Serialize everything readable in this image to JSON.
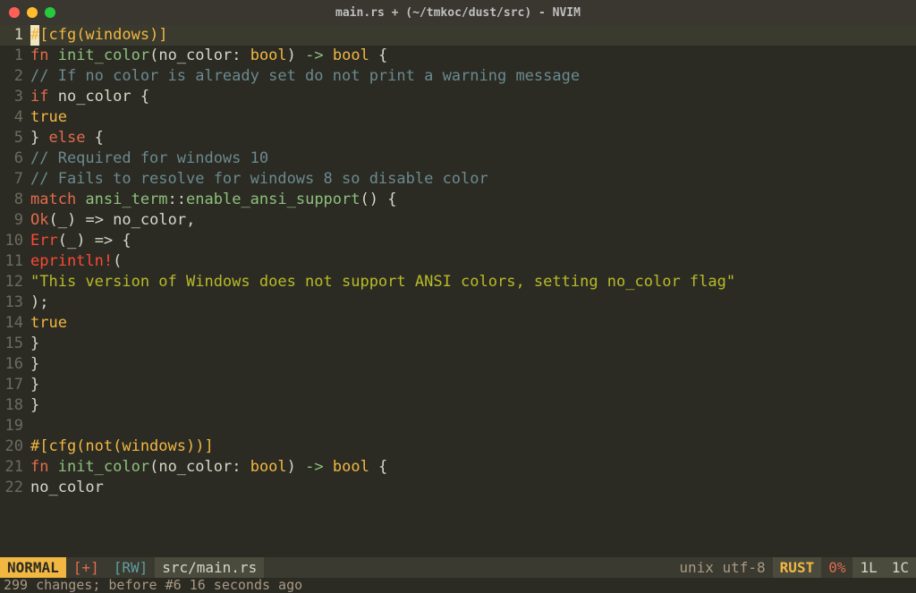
{
  "window": {
    "title": "main.rs + (~/tmkoc/dust/src) - NVIM"
  },
  "cursor": {
    "line": 1,
    "col": 1
  },
  "code": [
    {
      "n": 1,
      "tokens": [
        [
          "cursor",
          "#"
        ],
        [
          "attr",
          "[cfg(windows)]"
        ]
      ]
    },
    {
      "n": 1,
      "tokens": [
        [
          "kw",
          "fn "
        ],
        [
          "fn",
          "init_color"
        ],
        [
          "op",
          "("
        ],
        [
          "id",
          "no_color"
        ],
        [
          "op",
          ": "
        ],
        [
          "ty",
          "bool"
        ],
        [
          "op",
          ") "
        ],
        [
          "arr",
          "-> "
        ],
        [
          "ty",
          "bool"
        ],
        [
          "op",
          " {"
        ]
      ]
    },
    {
      "n": 2,
      "tokens": [
        [
          "cmt",
          "// If no color is already set do not print a warning message"
        ]
      ]
    },
    {
      "n": 3,
      "tokens": [
        [
          "kw",
          "if "
        ],
        [
          "id",
          "no_color"
        ],
        [
          "op",
          " {"
        ]
      ]
    },
    {
      "n": 4,
      "tokens": [
        [
          "ty",
          "true"
        ]
      ]
    },
    {
      "n": 5,
      "tokens": [
        [
          "op",
          "} "
        ],
        [
          "kw",
          "else"
        ],
        [
          "op",
          " {"
        ]
      ]
    },
    {
      "n": 6,
      "tokens": [
        [
          "cmt",
          "// Required for windows 10"
        ]
      ]
    },
    {
      "n": 7,
      "tokens": [
        [
          "cmt",
          "// Fails to resolve for windows 8 so disable color"
        ]
      ]
    },
    {
      "n": 8,
      "tokens": [
        [
          "kw",
          "match "
        ],
        [
          "pth",
          "ansi_term"
        ],
        [
          "op",
          "::"
        ],
        [
          "fn",
          "enable_ansi_support"
        ],
        [
          "op",
          "() {"
        ]
      ]
    },
    {
      "n": 9,
      "tokens": [
        [
          "ok",
          "Ok"
        ],
        [
          "op",
          "("
        ],
        [
          "id",
          "_"
        ],
        [
          "op",
          ") => "
        ],
        [
          "id",
          "no_color"
        ],
        [
          "op",
          ","
        ]
      ]
    },
    {
      "n": 10,
      "tokens": [
        [
          "err",
          "Err"
        ],
        [
          "op",
          "("
        ],
        [
          "id",
          "_"
        ],
        [
          "op",
          ") => {"
        ]
      ]
    },
    {
      "n": 11,
      "tokens": [
        [
          "err",
          "eprintln!"
        ],
        [
          "op",
          "("
        ]
      ]
    },
    {
      "n": 12,
      "tokens": [
        [
          "str",
          "\"This version of Windows does not support ANSI colors, setting no_color flag\""
        ]
      ]
    },
    {
      "n": 13,
      "tokens": [
        [
          "op",
          ");"
        ]
      ]
    },
    {
      "n": 14,
      "tokens": [
        [
          "ty",
          "true"
        ]
      ]
    },
    {
      "n": 15,
      "tokens": [
        [
          "op",
          "}"
        ]
      ]
    },
    {
      "n": 16,
      "tokens": [
        [
          "op",
          "}"
        ]
      ]
    },
    {
      "n": 17,
      "tokens": [
        [
          "op",
          "}"
        ]
      ]
    },
    {
      "n": 18,
      "tokens": [
        [
          "op",
          "}"
        ]
      ]
    },
    {
      "n": 19,
      "tokens": []
    },
    {
      "n": 20,
      "tokens": [
        [
          "attr",
          "#[cfg(not(windows))]"
        ]
      ]
    },
    {
      "n": 21,
      "tokens": [
        [
          "kw",
          "fn "
        ],
        [
          "fn",
          "init_color"
        ],
        [
          "op",
          "("
        ],
        [
          "id",
          "no_color"
        ],
        [
          "op",
          ": "
        ],
        [
          "ty",
          "bool"
        ],
        [
          "op",
          ") "
        ],
        [
          "arr",
          "-> "
        ],
        [
          "ty",
          "bool"
        ],
        [
          "op",
          " {"
        ]
      ]
    },
    {
      "n": 22,
      "tokens": [
        [
          "id",
          "no_color"
        ]
      ]
    }
  ],
  "status": {
    "mode": " NORMAL ",
    "modified": "[+]",
    "rw": "[RW]",
    "file": "src/main.rs",
    "encoding": "unix utf-8",
    "filetype": "RUST",
    "percent": "0%",
    "line": "1L",
    "col": "1C"
  },
  "cmdline": "299 changes; before #6  16 seconds ago"
}
